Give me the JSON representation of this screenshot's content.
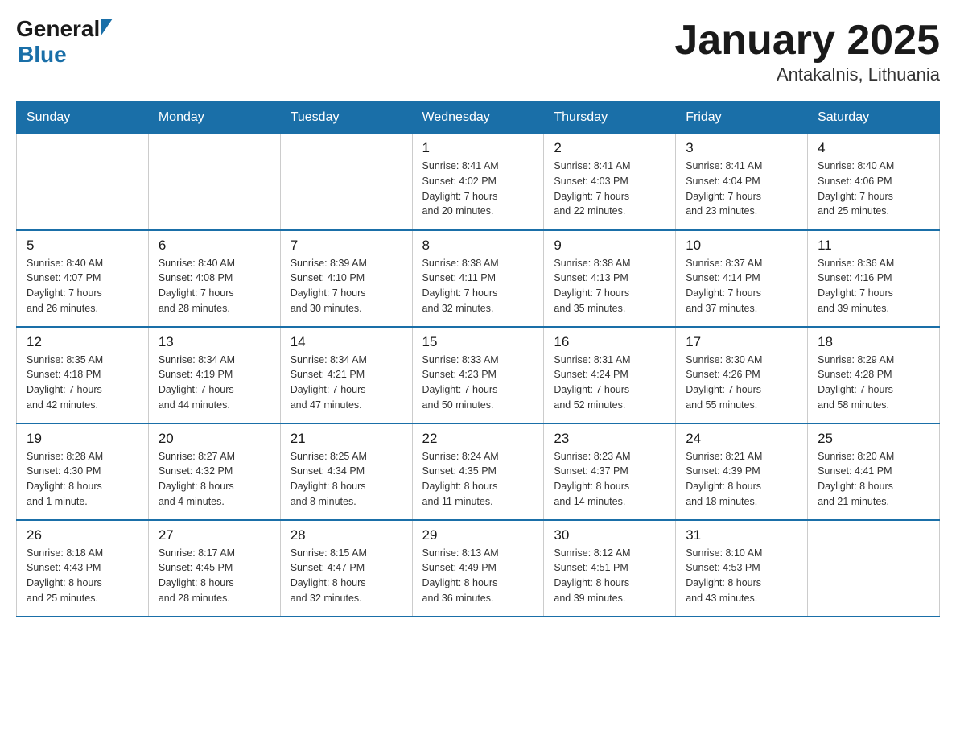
{
  "header": {
    "logo": {
      "general": "General",
      "blue": "Blue"
    },
    "title": "January 2025",
    "subtitle": "Antakalnis, Lithuania"
  },
  "days_of_week": [
    "Sunday",
    "Monday",
    "Tuesday",
    "Wednesday",
    "Thursday",
    "Friday",
    "Saturday"
  ],
  "weeks": [
    [
      {
        "day": "",
        "info": ""
      },
      {
        "day": "",
        "info": ""
      },
      {
        "day": "",
        "info": ""
      },
      {
        "day": "1",
        "info": "Sunrise: 8:41 AM\nSunset: 4:02 PM\nDaylight: 7 hours\nand 20 minutes."
      },
      {
        "day": "2",
        "info": "Sunrise: 8:41 AM\nSunset: 4:03 PM\nDaylight: 7 hours\nand 22 minutes."
      },
      {
        "day": "3",
        "info": "Sunrise: 8:41 AM\nSunset: 4:04 PM\nDaylight: 7 hours\nand 23 minutes."
      },
      {
        "day": "4",
        "info": "Sunrise: 8:40 AM\nSunset: 4:06 PM\nDaylight: 7 hours\nand 25 minutes."
      }
    ],
    [
      {
        "day": "5",
        "info": "Sunrise: 8:40 AM\nSunset: 4:07 PM\nDaylight: 7 hours\nand 26 minutes."
      },
      {
        "day": "6",
        "info": "Sunrise: 8:40 AM\nSunset: 4:08 PM\nDaylight: 7 hours\nand 28 minutes."
      },
      {
        "day": "7",
        "info": "Sunrise: 8:39 AM\nSunset: 4:10 PM\nDaylight: 7 hours\nand 30 minutes."
      },
      {
        "day": "8",
        "info": "Sunrise: 8:38 AM\nSunset: 4:11 PM\nDaylight: 7 hours\nand 32 minutes."
      },
      {
        "day": "9",
        "info": "Sunrise: 8:38 AM\nSunset: 4:13 PM\nDaylight: 7 hours\nand 35 minutes."
      },
      {
        "day": "10",
        "info": "Sunrise: 8:37 AM\nSunset: 4:14 PM\nDaylight: 7 hours\nand 37 minutes."
      },
      {
        "day": "11",
        "info": "Sunrise: 8:36 AM\nSunset: 4:16 PM\nDaylight: 7 hours\nand 39 minutes."
      }
    ],
    [
      {
        "day": "12",
        "info": "Sunrise: 8:35 AM\nSunset: 4:18 PM\nDaylight: 7 hours\nand 42 minutes."
      },
      {
        "day": "13",
        "info": "Sunrise: 8:34 AM\nSunset: 4:19 PM\nDaylight: 7 hours\nand 44 minutes."
      },
      {
        "day": "14",
        "info": "Sunrise: 8:34 AM\nSunset: 4:21 PM\nDaylight: 7 hours\nand 47 minutes."
      },
      {
        "day": "15",
        "info": "Sunrise: 8:33 AM\nSunset: 4:23 PM\nDaylight: 7 hours\nand 50 minutes."
      },
      {
        "day": "16",
        "info": "Sunrise: 8:31 AM\nSunset: 4:24 PM\nDaylight: 7 hours\nand 52 minutes."
      },
      {
        "day": "17",
        "info": "Sunrise: 8:30 AM\nSunset: 4:26 PM\nDaylight: 7 hours\nand 55 minutes."
      },
      {
        "day": "18",
        "info": "Sunrise: 8:29 AM\nSunset: 4:28 PM\nDaylight: 7 hours\nand 58 minutes."
      }
    ],
    [
      {
        "day": "19",
        "info": "Sunrise: 8:28 AM\nSunset: 4:30 PM\nDaylight: 8 hours\nand 1 minute."
      },
      {
        "day": "20",
        "info": "Sunrise: 8:27 AM\nSunset: 4:32 PM\nDaylight: 8 hours\nand 4 minutes."
      },
      {
        "day": "21",
        "info": "Sunrise: 8:25 AM\nSunset: 4:34 PM\nDaylight: 8 hours\nand 8 minutes."
      },
      {
        "day": "22",
        "info": "Sunrise: 8:24 AM\nSunset: 4:35 PM\nDaylight: 8 hours\nand 11 minutes."
      },
      {
        "day": "23",
        "info": "Sunrise: 8:23 AM\nSunset: 4:37 PM\nDaylight: 8 hours\nand 14 minutes."
      },
      {
        "day": "24",
        "info": "Sunrise: 8:21 AM\nSunset: 4:39 PM\nDaylight: 8 hours\nand 18 minutes."
      },
      {
        "day": "25",
        "info": "Sunrise: 8:20 AM\nSunset: 4:41 PM\nDaylight: 8 hours\nand 21 minutes."
      }
    ],
    [
      {
        "day": "26",
        "info": "Sunrise: 8:18 AM\nSunset: 4:43 PM\nDaylight: 8 hours\nand 25 minutes."
      },
      {
        "day": "27",
        "info": "Sunrise: 8:17 AM\nSunset: 4:45 PM\nDaylight: 8 hours\nand 28 minutes."
      },
      {
        "day": "28",
        "info": "Sunrise: 8:15 AM\nSunset: 4:47 PM\nDaylight: 8 hours\nand 32 minutes."
      },
      {
        "day": "29",
        "info": "Sunrise: 8:13 AM\nSunset: 4:49 PM\nDaylight: 8 hours\nand 36 minutes."
      },
      {
        "day": "30",
        "info": "Sunrise: 8:12 AM\nSunset: 4:51 PM\nDaylight: 8 hours\nand 39 minutes."
      },
      {
        "day": "31",
        "info": "Sunrise: 8:10 AM\nSunset: 4:53 PM\nDaylight: 8 hours\nand 43 minutes."
      },
      {
        "day": "",
        "info": ""
      }
    ]
  ]
}
